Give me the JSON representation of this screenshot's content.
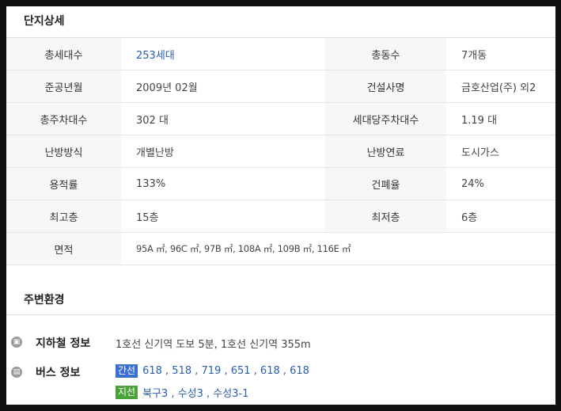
{
  "detail": {
    "title": "단지상세",
    "rows": [
      {
        "l1": "총세대수",
        "v1": "253세대",
        "l2": "총동수",
        "v2": "7개동"
      },
      {
        "l1": "준공년월",
        "v1": "2009년 02월",
        "l2": "건설사명",
        "v2": "금호산업(주) 외2"
      },
      {
        "l1": "총주차대수",
        "v1": "302 대",
        "l2": "세대당주차대수",
        "v2": "1.19 대"
      },
      {
        "l1": "난방방식",
        "v1": "개별난방",
        "l2": "난방연료",
        "v2": "도시가스"
      },
      {
        "l1": "용적률",
        "v1": "133%",
        "l2": "건폐율",
        "v2": "24%"
      },
      {
        "l1": "최고층",
        "v1": "15층",
        "l2": "최저층",
        "v2": "6층"
      }
    ],
    "area_label": "면적",
    "area_value": "95A ㎡, 96C ㎡, 97B ㎡, 108A ㎡, 109B ㎡, 116E ㎡"
  },
  "environment": {
    "title": "주변환경",
    "subway": {
      "label": "지하철 정보",
      "text": "1호선 신기역 도보 5분, 1호선 신기역 355m",
      "icon": "subway-icon"
    },
    "bus": {
      "label": "버스 정보",
      "icon": "bus-icon",
      "main_badge": "간선",
      "main_routes": "618 , 518 , 719 , 651 , 618 , 618",
      "branch_badge": "지선",
      "branch_routes": "북구3 , 수성3 , 수성3-1"
    }
  },
  "colors": {
    "link": "#2a5db0",
    "badge_blue": "#3a6fd0",
    "badge_green": "#49a23a"
  }
}
